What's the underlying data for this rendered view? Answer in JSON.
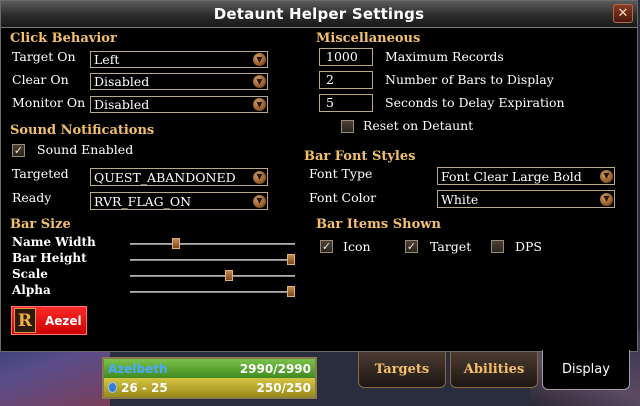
{
  "window": {
    "title": "Detaunt Helper Settings",
    "close_icon": "close-icon"
  },
  "click_behavior": {
    "title": "Click Behavior",
    "rows": [
      {
        "label": "Target On",
        "value": "Left"
      },
      {
        "label": "Clear On",
        "value": "Disabled"
      },
      {
        "label": "Monitor On",
        "value": "Disabled"
      }
    ]
  },
  "sound": {
    "title": "Sound Notifications",
    "enabled_label": "Sound Enabled",
    "enabled": true,
    "targeted_label": "Targeted",
    "targeted_value": "QUEST_ABANDONED",
    "ready_label": "Ready",
    "ready_value": "RVR_FLAG_ON"
  },
  "bar_size": {
    "title": "Bar Size",
    "sliders": [
      {
        "label": "Name Width",
        "value": 0.28
      },
      {
        "label": "Bar Height",
        "value": 1.0
      },
      {
        "label": "Scale",
        "value": 0.6
      },
      {
        "label": "Alpha",
        "value": 1.0
      }
    ]
  },
  "player": {
    "name": "Aezel",
    "rank_glyph": "R"
  },
  "misc": {
    "title": "Miscellaneous",
    "fields": [
      {
        "value": "1000",
        "label": "Maximum Records"
      },
      {
        "value": "2",
        "label": "Number of Bars to Display"
      },
      {
        "value": "5",
        "label": "Seconds to Delay Expiration"
      }
    ],
    "reset_label": "Reset on Detaunt",
    "reset_checked": false
  },
  "bar_font": {
    "title": "Bar Font Styles",
    "type_label": "Font Type",
    "type_value": "Font Clear Large Bold",
    "color_label": "Font Color",
    "color_value": "White"
  },
  "bar_items": {
    "title": "Bar Items Shown",
    "items": [
      {
        "label": "Icon",
        "checked": true
      },
      {
        "label": "Target",
        "checked": true
      },
      {
        "label": "DPS",
        "checked": false
      }
    ]
  },
  "unit_frame": {
    "name": "Azelbeth",
    "hp": "2990/2990",
    "level_range": "26 - 25",
    "ap": "250/250"
  },
  "tabs": [
    {
      "label": "Targets",
      "active": false
    },
    {
      "label": "Abilities",
      "active": false
    },
    {
      "label": "Display",
      "active": true
    }
  ],
  "check_glyph": "✓"
}
